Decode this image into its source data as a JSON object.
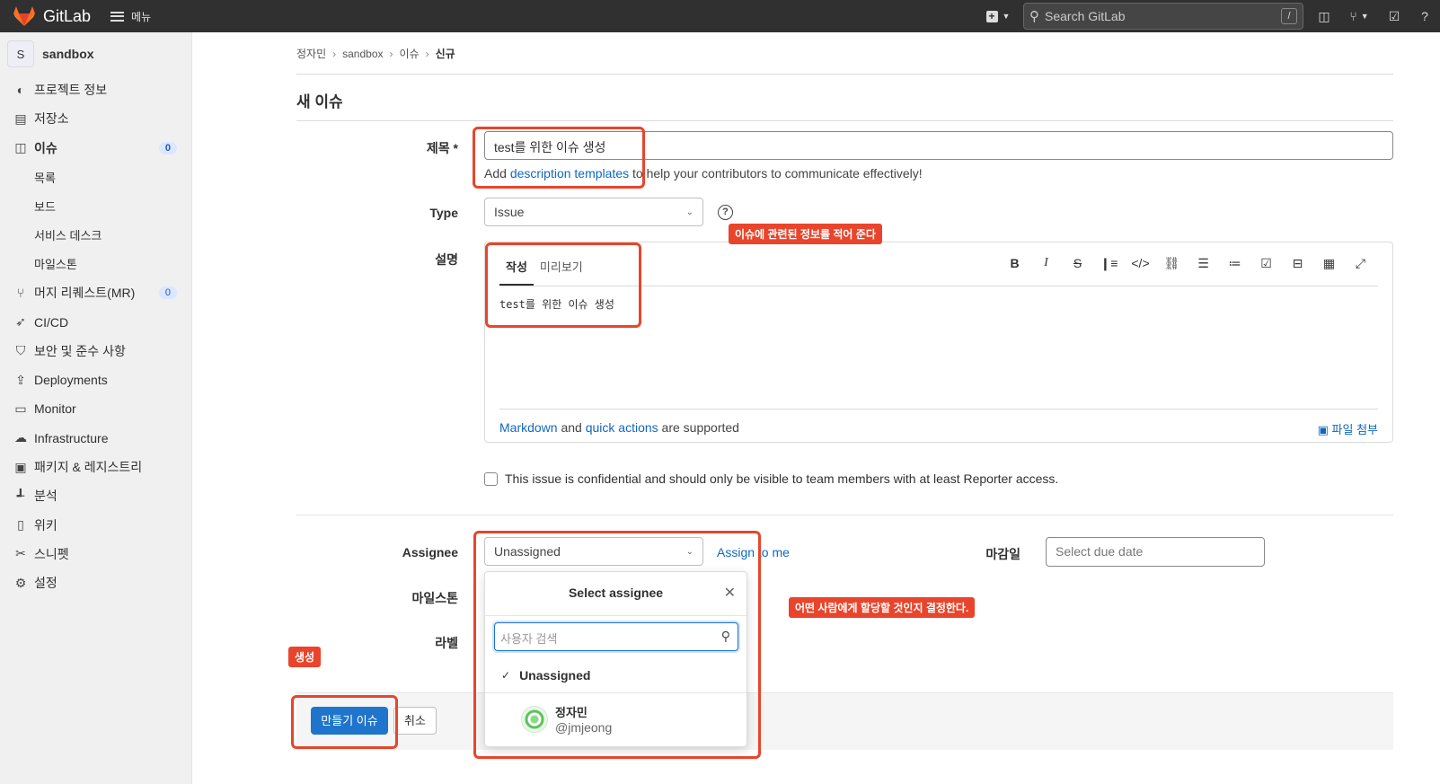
{
  "topbar": {
    "brand": "GitLab",
    "menu_label": "메뉴",
    "search_placeholder": "Search GitLab",
    "search_shortcut": "/"
  },
  "sidebar": {
    "project_initial": "S",
    "project_name": "sandbox",
    "items": [
      {
        "label": "프로젝트 정보",
        "icon": "info-icon"
      },
      {
        "label": "저장소",
        "icon": "doc-icon"
      },
      {
        "label": "이슈",
        "icon": "issues-icon",
        "count": "0"
      },
      {
        "label": "목록"
      },
      {
        "label": "보드"
      },
      {
        "label": "서비스 데스크"
      },
      {
        "label": "마일스톤"
      },
      {
        "label": "머지 리퀘스트(MR)",
        "icon": "merge-request-icon",
        "count": "0"
      },
      {
        "label": "CI/CD",
        "icon": "rocket-icon"
      },
      {
        "label": "보안 및 준수 사항",
        "icon": "shield-icon"
      },
      {
        "label": "Deployments",
        "icon": "deploy-icon"
      },
      {
        "label": "Monitor",
        "icon": "monitor-icon"
      },
      {
        "label": "Infrastructure",
        "icon": "cloud-icon"
      },
      {
        "label": "패키지 & 레지스트리",
        "icon": "package-icon"
      },
      {
        "label": "분석",
        "icon": "chart-icon"
      },
      {
        "label": "위키",
        "icon": "book-icon"
      },
      {
        "label": "스니펫",
        "icon": "scissors-icon"
      },
      {
        "label": "설정",
        "icon": "gear-icon"
      }
    ]
  },
  "breadcrumb": [
    "정자민",
    "sandbox",
    "이슈",
    "신규"
  ],
  "page_title": "새 이슈",
  "form": {
    "title_label": "제목 *",
    "title_value": "test를 위한 이슈 생성",
    "help_prefix": "Add ",
    "help_link": "description templates",
    "help_suffix": " to help your contributors to communicate effectively!",
    "type_label": "Type",
    "type_value": "Issue",
    "description_label": "설명",
    "tab_write": "작성",
    "tab_preview": "미리보기",
    "description_value": "test를 위한 이슈 생성",
    "markdown_link": "Markdown",
    "and_text": " and ",
    "quick_actions_link": "quick actions",
    "supported_text": " are supported",
    "attach_label": "파일 첨부",
    "confidential_text": "This issue is confidential and should only be visible to team members with at least Reporter access.",
    "assignee_label": "Assignee",
    "assignee_value": "Unassigned",
    "assign_to_me": "Assign to me",
    "due_label": "마감일",
    "due_placeholder": "Select due date",
    "milestone_label": "마일스톤",
    "labels_label": "라벨"
  },
  "assignee_dropdown": {
    "header": "Select assignee",
    "search_placeholder": "사용자 검색",
    "unassigned": "Unassigned",
    "user_name": "정자민",
    "user_handle": "@jmjeong"
  },
  "buttons": {
    "create": "만들기 이슈",
    "cancel": "취소"
  },
  "annotations": {
    "description_note": "이슈에 관련된 정보를 적어 준다",
    "assignee_note": "어떤 사람에게 할당할 것인지  결정한다.",
    "create_note": "생성"
  },
  "colors": {
    "accent": "#1f75cb",
    "annotation": "#e8452c",
    "topbar": "#303030"
  }
}
